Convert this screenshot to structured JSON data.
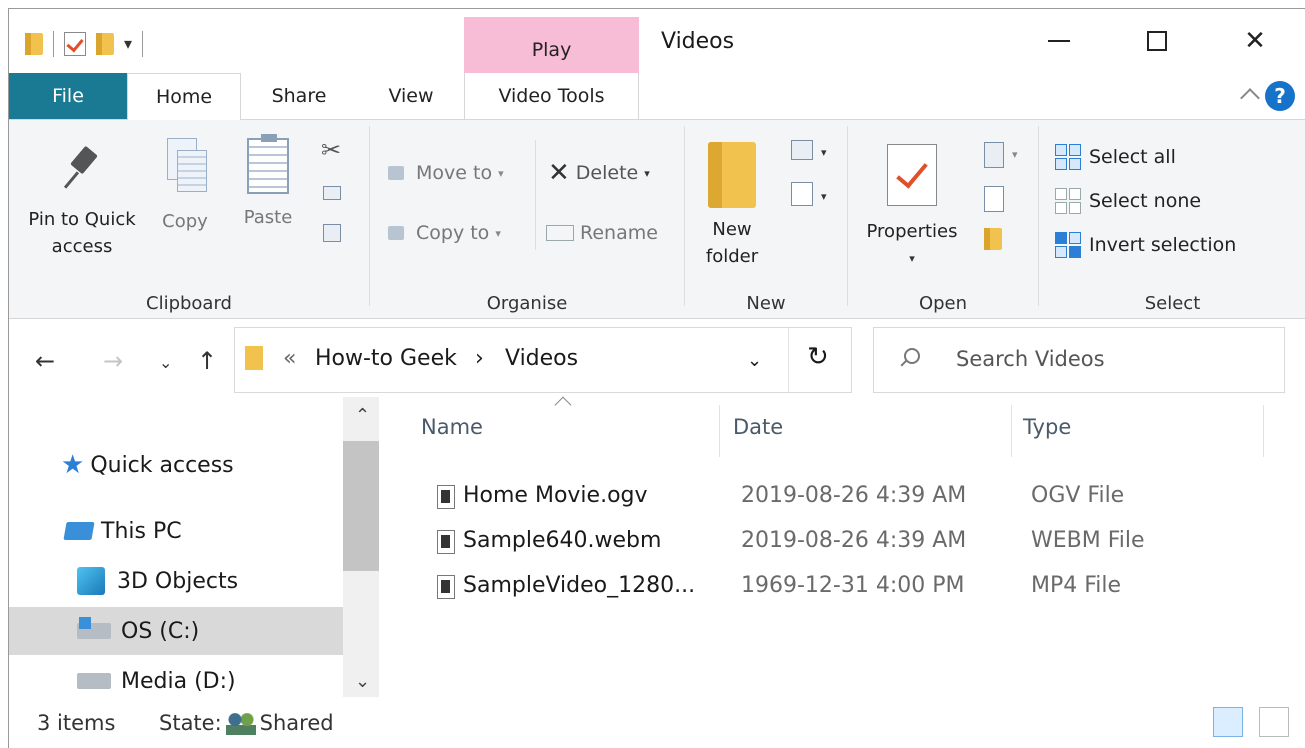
{
  "window": {
    "title": "Videos",
    "contextual_tab": "Play"
  },
  "tabs": {
    "file": "File",
    "home": "Home",
    "share": "Share",
    "view": "View",
    "video_tools": "Video Tools"
  },
  "ribbon": {
    "clipboard": {
      "label": "Clipboard",
      "pin": "Pin to Quick access",
      "pin_line1": "Pin to Quick",
      "pin_line2": "access",
      "copy": "Copy",
      "paste": "Paste"
    },
    "organise": {
      "label": "Organise",
      "move_to": "Move to",
      "copy_to": "Copy to",
      "delete": "Delete",
      "rename": "Rename"
    },
    "new": {
      "label": "New",
      "new_folder_line1": "New",
      "new_folder_line2": "folder"
    },
    "open": {
      "label": "Open",
      "properties": "Properties"
    },
    "select": {
      "label": "Select",
      "select_all": "Select all",
      "select_none": "Select none",
      "invert": "Invert selection"
    }
  },
  "address": {
    "overflow": "«",
    "crumbs": [
      "How-to Geek",
      "Videos"
    ],
    "separator": "›"
  },
  "search": {
    "placeholder": "Search Videos"
  },
  "nav": {
    "items": [
      "Quick access",
      "This PC",
      "3D Objects",
      "OS (C:)",
      "Media (D:)"
    ]
  },
  "columns": [
    "Name",
    "Date",
    "Type"
  ],
  "files": [
    {
      "name": "Home Movie.ogv",
      "date": "2019-08-26 4:39 AM",
      "type": "OGV File"
    },
    {
      "name": "Sample640.webm",
      "date": "2019-08-26 4:39 AM",
      "type": "WEBM File"
    },
    {
      "name": "SampleVideo_1280...",
      "date": "1969-12-31 4:00 PM",
      "type": "MP4 File"
    }
  ],
  "status": {
    "items": "3 items",
    "state_label": "State:",
    "state_value": "Shared"
  },
  "colors": {
    "file_tab": "#1a7a94",
    "play_tab": "#f8bdd6",
    "accent": "#2b7fd6"
  }
}
